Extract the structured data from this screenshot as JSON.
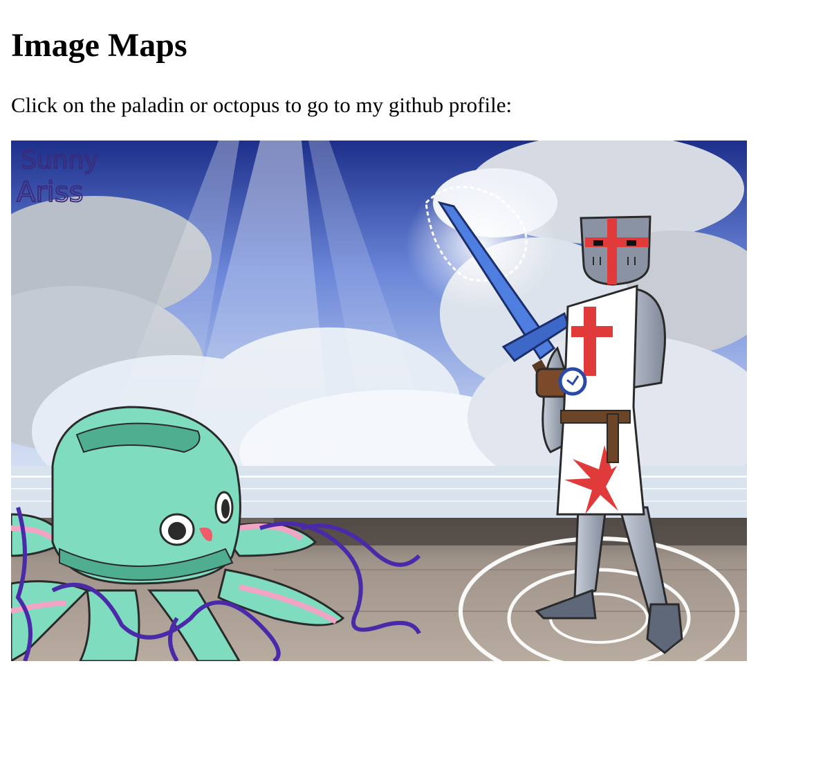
{
  "page": {
    "heading": "Image Maps",
    "intro": "Click on the paladin or octopus to go to my github profile:"
  },
  "artwork": {
    "signature": "Sunny Ariss",
    "hotspots": [
      "paladin",
      "octopus"
    ],
    "colors": {
      "sky_top": "#1c2f8a",
      "sky_mid": "#8fa8e8",
      "cloud": "#e6ecf5",
      "ground": "#9a8d84",
      "octopus": "#7fdcbf",
      "octopus_dark": "#4fae8f",
      "tentacle_pink": "#f2a4c4",
      "tentacle_vine": "#4a2aa8",
      "armor": "#9aa3b3",
      "tabard": "#ffffff",
      "cross": "#e03a3a",
      "sword": "#4d7ee0"
    }
  }
}
